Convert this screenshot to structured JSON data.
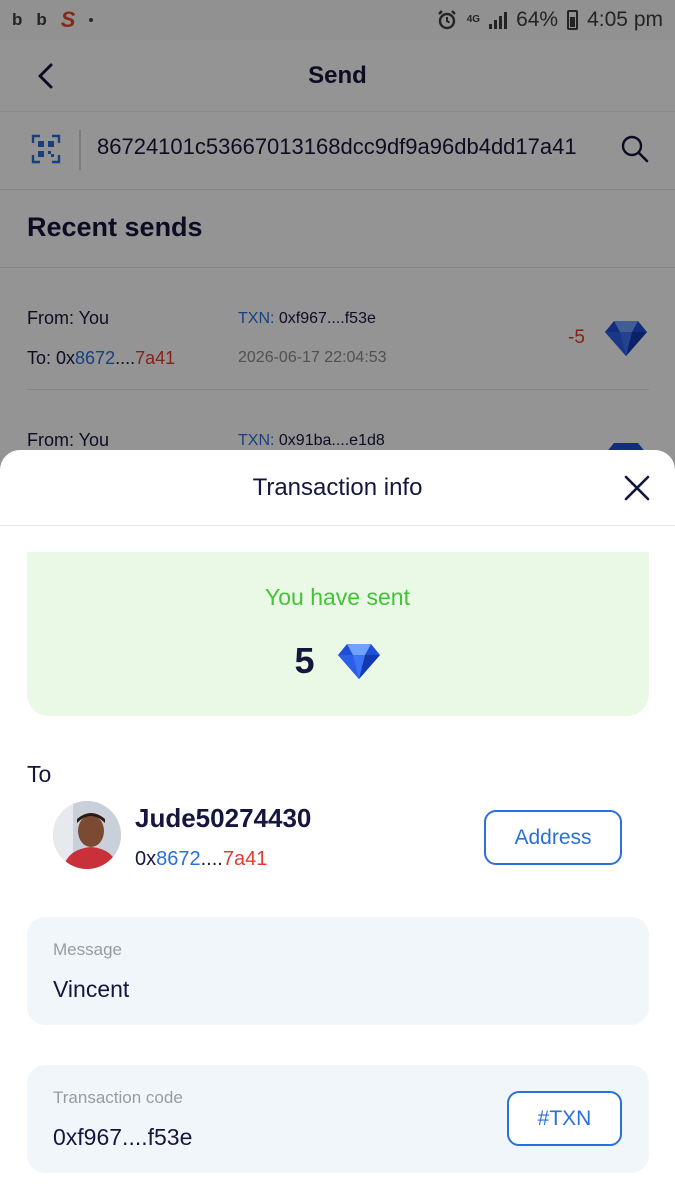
{
  "status_bar": {
    "app_icons": [
      "b",
      "b",
      "S"
    ],
    "network": "4G",
    "battery": "64%",
    "time": "4:05 pm",
    "icons": [
      "alarm-icon",
      "signal-icon",
      "battery-icon"
    ]
  },
  "header": {
    "title": "Send",
    "back_icon": "chevron-left-icon"
  },
  "search": {
    "value": "86724101c53667013168dcc9df9a96db4dd17a41",
    "icons": [
      "qr-scan-icon",
      "search-icon"
    ]
  },
  "recent": {
    "title": "Recent sends",
    "items": [
      {
        "from": "From: You",
        "to_prefix": "To: 0x",
        "to_mid": "8672",
        "to_dots": "....",
        "to_end": "7a41",
        "txn_label": "TXN:",
        "txn_value": " 0xf967....f53e",
        "date": "2026-06-17 22:04:53",
        "amount": "-5",
        "icon": "diamond-icon"
      },
      {
        "from": "From: You",
        "txn_label": "TXN:",
        "txn_value": " 0x91ba....e1d8"
      }
    ]
  },
  "sheet": {
    "title": "Transaction info",
    "close_icon": "close-icon",
    "sent_label": "You have sent",
    "sent_amount": "5",
    "to_label": "To",
    "recipient": {
      "name": "Jude50274430",
      "addr_prefix": "0x",
      "addr_mid": "8672",
      "addr_dots": "....",
      "addr_end": "7a41"
    },
    "address_button": "Address",
    "message_label": "Message",
    "message_value": "Vincent",
    "code_label": "Transaction code",
    "code_value": "0xf967....f53e",
    "txn_button": "#TXN"
  },
  "colors": {
    "accent": "#2a6fdb",
    "negative": "#e23b2e",
    "success": "#44c238",
    "success_bg": "#eaf8e6",
    "text": "#15163d"
  }
}
